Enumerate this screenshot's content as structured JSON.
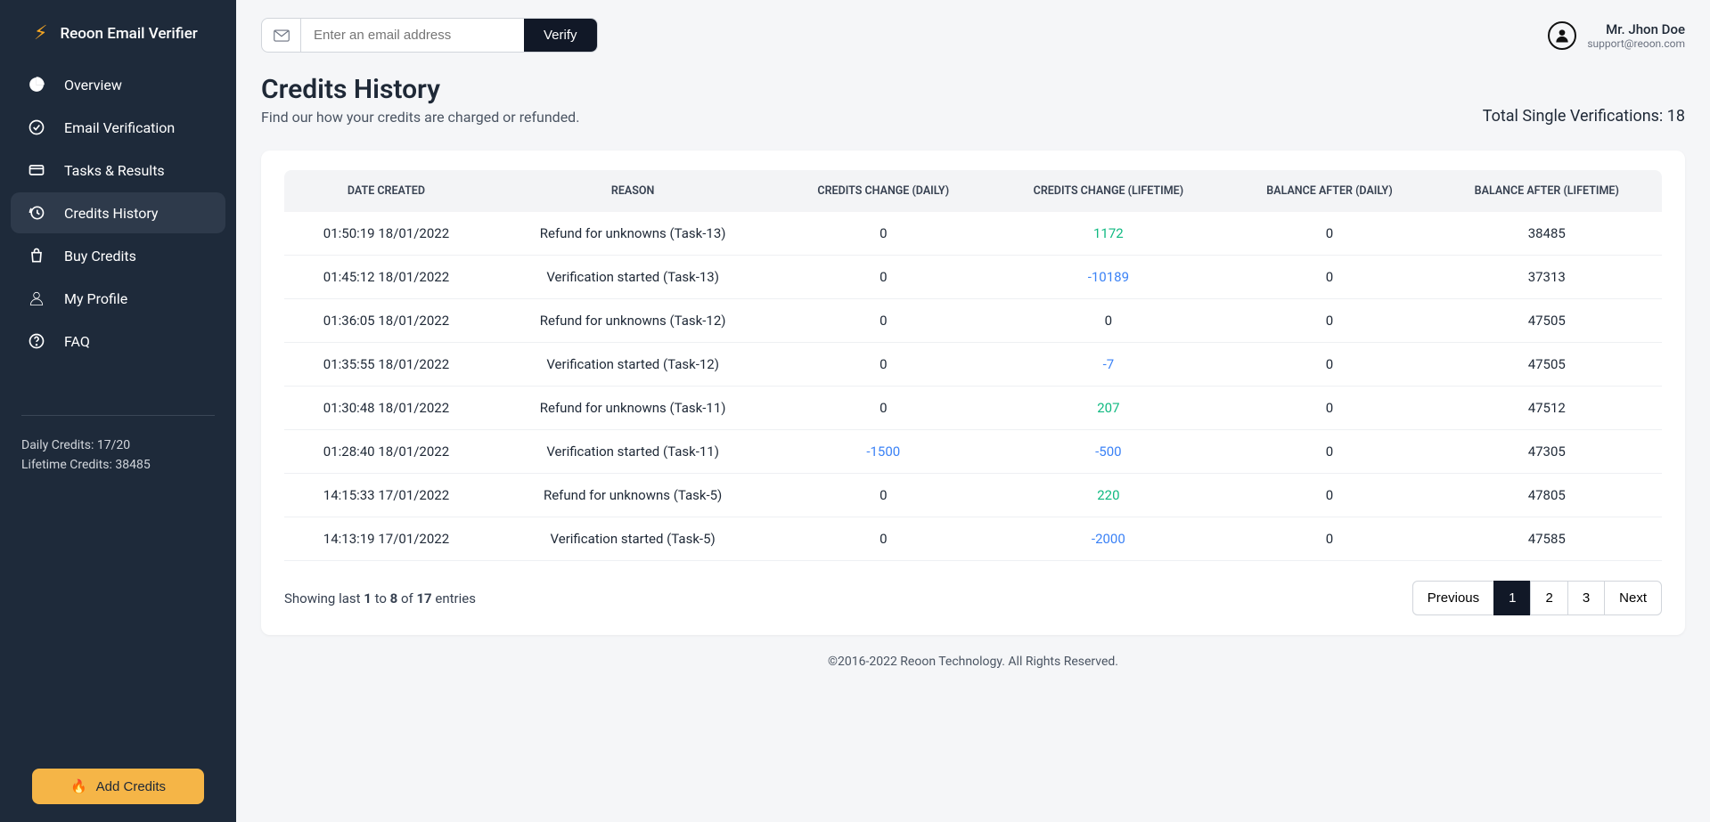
{
  "brand": "Reoon Email Verifier",
  "sidebar": {
    "items": [
      {
        "label": "Overview"
      },
      {
        "label": "Email Verification"
      },
      {
        "label": "Tasks & Results"
      },
      {
        "label": "Credits History"
      },
      {
        "label": "Buy Credits"
      },
      {
        "label": "My Profile"
      },
      {
        "label": "FAQ"
      }
    ],
    "daily_label": "Daily Credits: 17/20",
    "lifetime_label": "Lifetime Credits: 38485",
    "add_credits": "Add Credits"
  },
  "topbar": {
    "email_placeholder": "Enter an email address",
    "verify_label": "Verify"
  },
  "user": {
    "name": "Mr. Jhon Doe",
    "email": "support@reoon.com"
  },
  "page": {
    "title": "Credits History",
    "subtitle": "Find our how your credits are charged or refunded.",
    "total_label": "Total Single Verifications: 18"
  },
  "table": {
    "headers": [
      "DATE CREATED",
      "REASON",
      "CREDITS CHANGE (DAILY)",
      "CREDITS CHANGE (LIFETIME)",
      "BALANCE AFTER (DAILY)",
      "BALANCE AFTER (LIFETIME)"
    ],
    "rows": [
      {
        "date": "01:50:19 18/01/2022",
        "reason": "Refund for unknowns (Task-13)",
        "cd": "0",
        "cl": "1172",
        "cl_sign": "pos",
        "bd": "0",
        "bl": "38485"
      },
      {
        "date": "01:45:12 18/01/2022",
        "reason": "Verification started (Task-13)",
        "cd": "0",
        "cl": "-10189",
        "cl_sign": "neg",
        "bd": "0",
        "bl": "37313"
      },
      {
        "date": "01:36:05 18/01/2022",
        "reason": "Refund for unknowns (Task-12)",
        "cd": "0",
        "cl": "0",
        "cl_sign": "",
        "bd": "0",
        "bl": "47505"
      },
      {
        "date": "01:35:55 18/01/2022",
        "reason": "Verification started (Task-12)",
        "cd": "0",
        "cl": "-7",
        "cl_sign": "neg",
        "bd": "0",
        "bl": "47505"
      },
      {
        "date": "01:30:48 18/01/2022",
        "reason": "Refund for unknowns (Task-11)",
        "cd": "0",
        "cl": "207",
        "cl_sign": "pos",
        "bd": "0",
        "bl": "47512"
      },
      {
        "date": "01:28:40 18/01/2022",
        "reason": "Verification started (Task-11)",
        "cd": "-1500",
        "cd_sign": "neg",
        "cl": "-500",
        "cl_sign": "neg",
        "bd": "0",
        "bl": "47305"
      },
      {
        "date": "14:15:33 17/01/2022",
        "reason": "Refund for unknowns (Task-5)",
        "cd": "0",
        "cl": "220",
        "cl_sign": "pos",
        "bd": "0",
        "bl": "47805"
      },
      {
        "date": "14:13:19 17/01/2022",
        "reason": "Verification started (Task-5)",
        "cd": "0",
        "cl": "-2000",
        "cl_sign": "neg",
        "bd": "0",
        "bl": "47585"
      }
    ]
  },
  "table_footer": {
    "showing_pre": "Showing last ",
    "from": "1",
    "to_word": " to ",
    "to": "8",
    "of_word": " of ",
    "total": "17",
    "entries_word": " entries"
  },
  "pagination": {
    "prev": "Previous",
    "pages": [
      "1",
      "2",
      "3"
    ],
    "next": "Next"
  },
  "footer": "©2016-2022 Reoon Technology. All Rights Reserved."
}
